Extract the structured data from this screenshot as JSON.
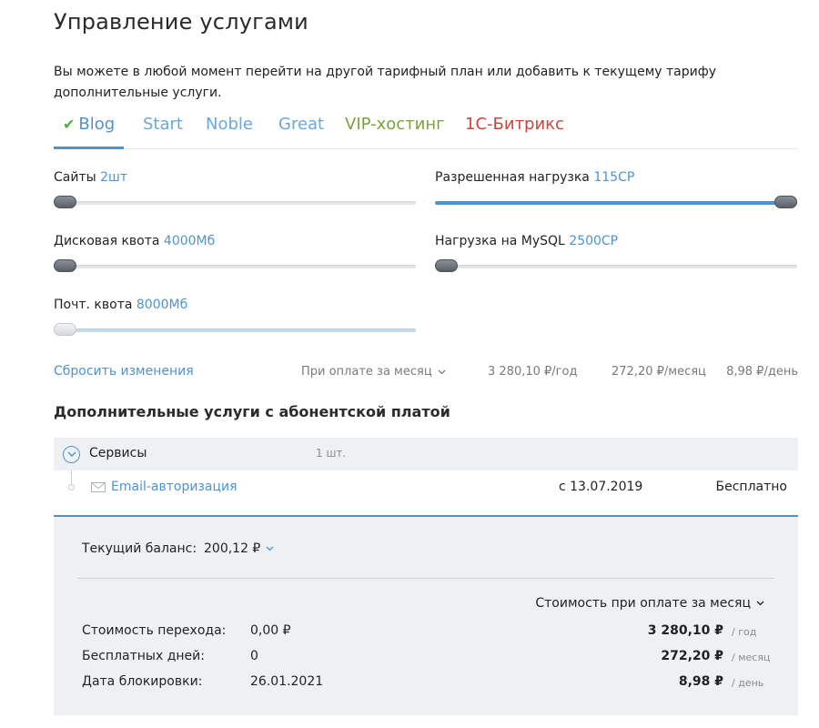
{
  "page": {
    "title": "Управление услугами",
    "intro": "Вы можете в любой момент перейти на другой тарифный план или добавить к текущему тарифу дополнительные услуги."
  },
  "tabs": [
    {
      "label": "Blog",
      "color": "#4f93cc",
      "active": true
    },
    {
      "label": "Start",
      "color": "#6ea6d6"
    },
    {
      "label": "Noble",
      "color": "#6ea6d6"
    },
    {
      "label": "Great",
      "color": "#6ea6d6"
    },
    {
      "label": "VIP-хостинг",
      "color": "#7aa23c"
    },
    {
      "label": "1С-Битрикс",
      "color": "#c9463d"
    }
  ],
  "sliders": {
    "sites": {
      "label": "Сайты",
      "value": "2шт",
      "level": 0
    },
    "load": {
      "label": "Разрешенная нагрузка",
      "value": "115CP",
      "level": 1
    },
    "disk": {
      "label": "Дисковая квота",
      "value": "4000Мб",
      "level": 0
    },
    "mysql": {
      "label": "Нагрузка на MySQL",
      "value": "2500CP",
      "level": 0
    },
    "mail": {
      "label": "Почт. квота",
      "value": "8000Мб",
      "level": 0
    }
  },
  "summary": {
    "reset": "Сбросить изменения",
    "period": "При оплате за месяц",
    "year": "3 280,10 ₽/год",
    "month": "272,20 ₽/месяц",
    "day": "8,98 ₽/день"
  },
  "services": {
    "title": "Дополнительные услуги с абонентской платой",
    "group": {
      "name": "Сервисы",
      "count": "1 шт."
    },
    "items": [
      {
        "name": "Email-авторизация",
        "date": "с 13.07.2019",
        "price": "Бесплатно"
      }
    ]
  },
  "balance": {
    "label": "Текущий баланс:",
    "value": "200,12 ₽",
    "cost_period": "Стоимость при оплате за месяц",
    "rows": [
      {
        "label": "Стоимость перехода:",
        "value": "0,00 ₽",
        "amount": "3 280,10 ₽",
        "unit": "/ год"
      },
      {
        "label": "Бесплатных дней:",
        "value": "0",
        "amount": "272,20 ₽",
        "unit": "/ месяц"
      },
      {
        "label": "Дата блокировки:",
        "value": "26.01.2021",
        "amount": "8,98 ₽",
        "unit": "/ день"
      }
    ]
  },
  "colors": {
    "accent": "#4f93cc",
    "panel": "#eef1f4",
    "check": "#4caf50"
  }
}
